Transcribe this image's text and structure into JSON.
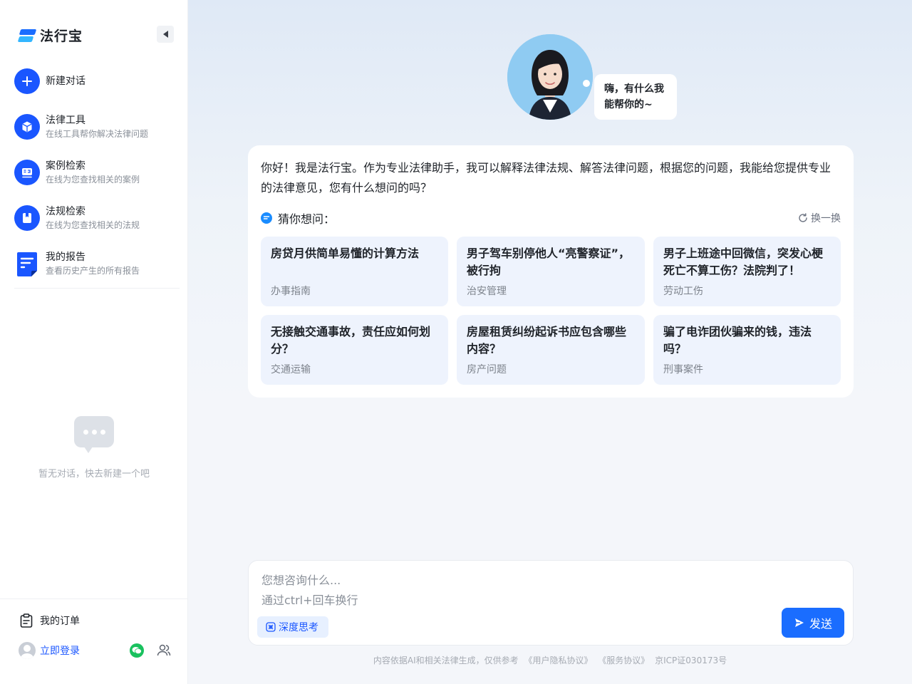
{
  "brand": {
    "name": "法行宝"
  },
  "sidebar": {
    "new_chat": {
      "label": "新建对话"
    },
    "items": [
      {
        "title": "法律工具",
        "sub": "在线工具帮你解决法律问题"
      },
      {
        "title": "案例检索",
        "sub": "在线为您查找相关的案例"
      },
      {
        "title": "法规检索",
        "sub": "在线为您查找相关的法规"
      },
      {
        "title": "我的报告",
        "sub": "查看历史产生的所有报告"
      }
    ],
    "empty_text": "暂无对话，快去新建一个吧",
    "orders": "我的订单",
    "login": "立即登录"
  },
  "hero": {
    "bubble": "嗨，有什么我能帮你的~"
  },
  "intro": {
    "greeting": "你好！我是法行宝。作为专业法律助手，我可以解释法律法规、解答法律问题，根据您的问题，我能给您提供专业的法律意见，您有什么想问的吗？",
    "guess_title": "猜你想问：",
    "refresh": "换一换"
  },
  "questions": [
    {
      "title": "房贷月供简单易懂的计算方法",
      "tag": "办事指南"
    },
    {
      "title": "男子驾车别停他人“亮警察证”，被行拘",
      "tag": "治安管理"
    },
    {
      "title": "男子上班途中回微信，突发心梗死亡不算工伤？法院判了！",
      "tag": "劳动工伤"
    },
    {
      "title": "无接触交通事故，责任应如何划分？",
      "tag": "交通运输"
    },
    {
      "title": "房屋租赁纠纷起诉书应包含哪些内容？",
      "tag": "房产问题"
    },
    {
      "title": "骗了电诈团伙骗来的钱，违法吗？",
      "tag": "刑事案件"
    }
  ],
  "input": {
    "placeholder_line1": "您想咨询什么...",
    "placeholder_line2": "通过ctrl+回车换行",
    "deep_think": "深度思考",
    "send": "发送"
  },
  "footer": {
    "disclaimer": "内容依据AI和相关法律生成，仅供参考",
    "privacy": "《用户隐私协议》",
    "service": "《服务协议》",
    "icp": "京ICP证030173号"
  },
  "colors": {
    "accent": "#1a56ff",
    "send": "#1a6dff",
    "card_bg": "#eef3fd"
  }
}
